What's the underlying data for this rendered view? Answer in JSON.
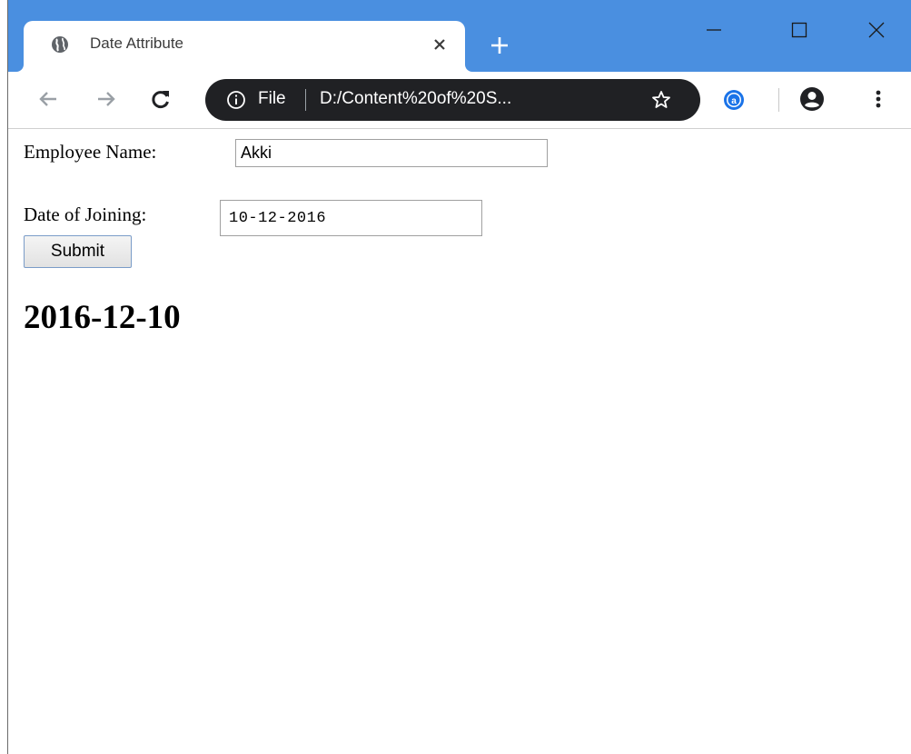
{
  "browser": {
    "tab": {
      "title": "Date Attribute",
      "favicon": "globe-icon"
    },
    "window_controls": [
      "minimize-icon",
      "maximize-icon",
      "close-icon"
    ],
    "toolbar": {
      "omnibox": {
        "scheme_label": "File",
        "url": "D:/Content%20of%20S...",
        "info_icon": "info-icon",
        "bookmark_icon": "star-icon"
      },
      "extension_icon": "extension-a-icon",
      "profile_icon": "profile-icon",
      "menu_icon": "more-vertical-icon"
    },
    "colors": {
      "title_bar": "#4a8fe0",
      "omnibox": "#202124"
    }
  },
  "page": {
    "form": {
      "employee_name_label": "Employee Name:",
      "employee_name_value": "Akki",
      "date_label": "Date of Joining:",
      "date_value": "10-12-2016",
      "submit_label": "Submit"
    },
    "result_heading": "2016-12-10"
  }
}
